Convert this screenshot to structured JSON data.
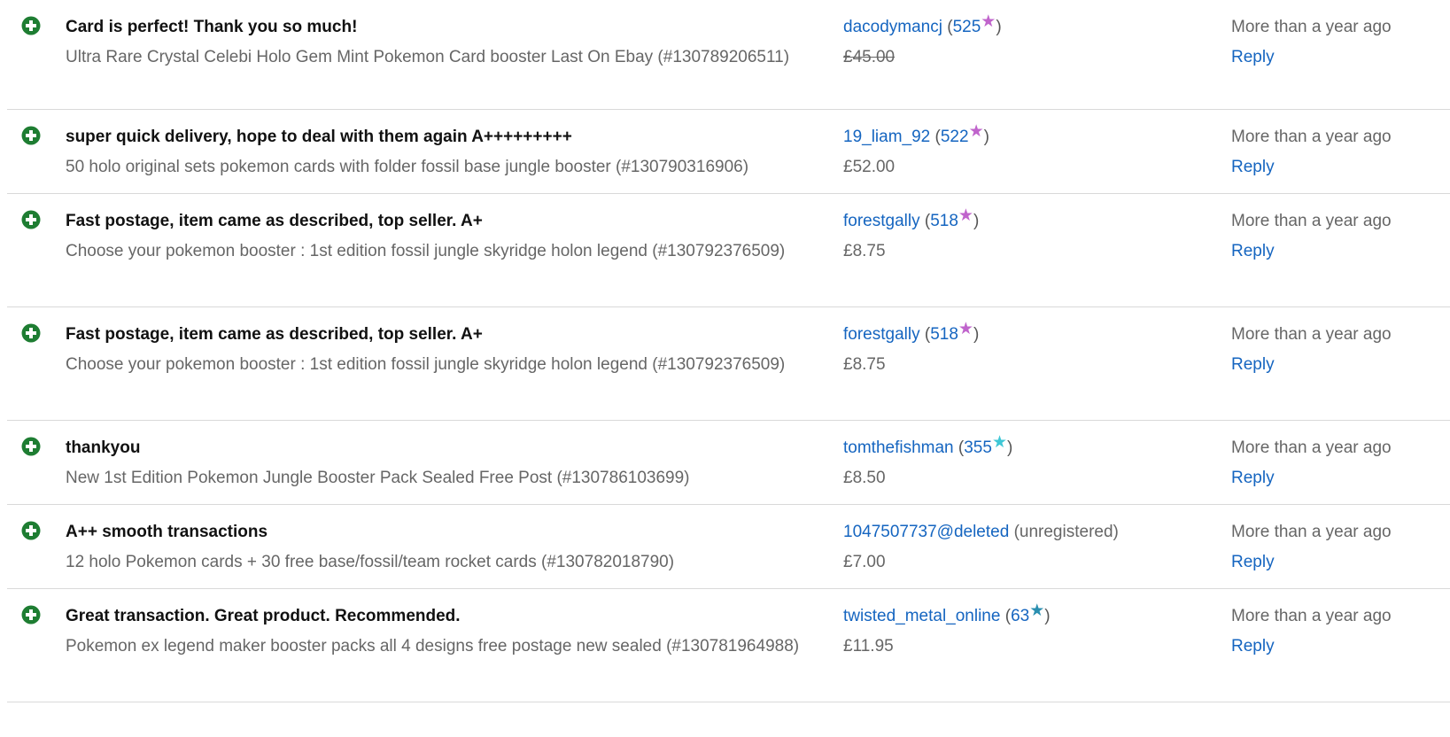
{
  "colors": {
    "positive_icon": "#1e7d32",
    "link": "#1565c0",
    "star_purple": "#c064cc",
    "star_turquoise": "#3fc7d6",
    "star_teal": "#2a8fb0"
  },
  "feedback": [
    {
      "comment": "Card is perfect! Thank you so much!",
      "item": "Ultra Rare Crystal Celebi Holo Gem Mint Pokemon Card booster Last On Ebay (#130789206511)",
      "username": "dacodymancj",
      "score": "525",
      "star_icon": "purple-star-icon",
      "price": "£45.00",
      "price_struck": true,
      "time": "More than a year ago",
      "reply": "Reply"
    },
    {
      "comment": "super quick delivery, hope to deal with them again A+++++++++",
      "item": "50 holo original sets pokemon cards with folder fossil base jungle booster (#130790316906)",
      "username": "19_liam_92",
      "score": "522",
      "star_icon": "purple-star-icon",
      "price": "£52.00",
      "price_struck": false,
      "time": "More than a year ago",
      "reply": "Reply"
    },
    {
      "comment": "Fast postage, item came as described, top seller. A+",
      "item": "Choose your pokemon booster : 1st edition fossil jungle skyridge holon legend (#130792376509)",
      "username": "forestgally",
      "score": "518",
      "star_icon": "purple-star-icon",
      "price": "£8.75",
      "price_struck": false,
      "time": "More than a year ago",
      "reply": "Reply"
    },
    {
      "comment": "Fast postage, item came as described, top seller. A+",
      "item": "Choose your pokemon booster : 1st edition fossil jungle skyridge holon legend (#130792376509)",
      "username": "forestgally",
      "score": "518",
      "star_icon": "purple-star-icon",
      "price": "£8.75",
      "price_struck": false,
      "time": "More than a year ago",
      "reply": "Reply"
    },
    {
      "comment": "thankyou",
      "item": "New 1st Edition Pokemon Jungle Booster Pack Sealed Free Post (#130786103699)",
      "username": "tomthefishman",
      "score": "355",
      "star_icon": "turquoise-star-icon",
      "price": "£8.50",
      "price_struck": false,
      "time": "More than a year ago",
      "reply": "Reply"
    },
    {
      "comment": "A++ smooth transactions",
      "item": "12 holo Pokemon cards + 30 free base/fossil/team rocket cards (#130782018790)",
      "username": "1047507737@deleted",
      "unregistered": "(unregistered)",
      "price": "£7.00",
      "price_struck": false,
      "time": "More than a year ago",
      "reply": "Reply"
    },
    {
      "comment": "Great transaction. Great product. Recommended.",
      "item": "Pokemon ex legend maker booster packs all 4 designs free postage new sealed (#130781964988)",
      "username": "twisted_metal_online",
      "score": "63",
      "star_icon": "teal-star-icon",
      "price": "£11.95",
      "price_struck": false,
      "time": "More than a year ago",
      "reply": "Reply"
    }
  ]
}
